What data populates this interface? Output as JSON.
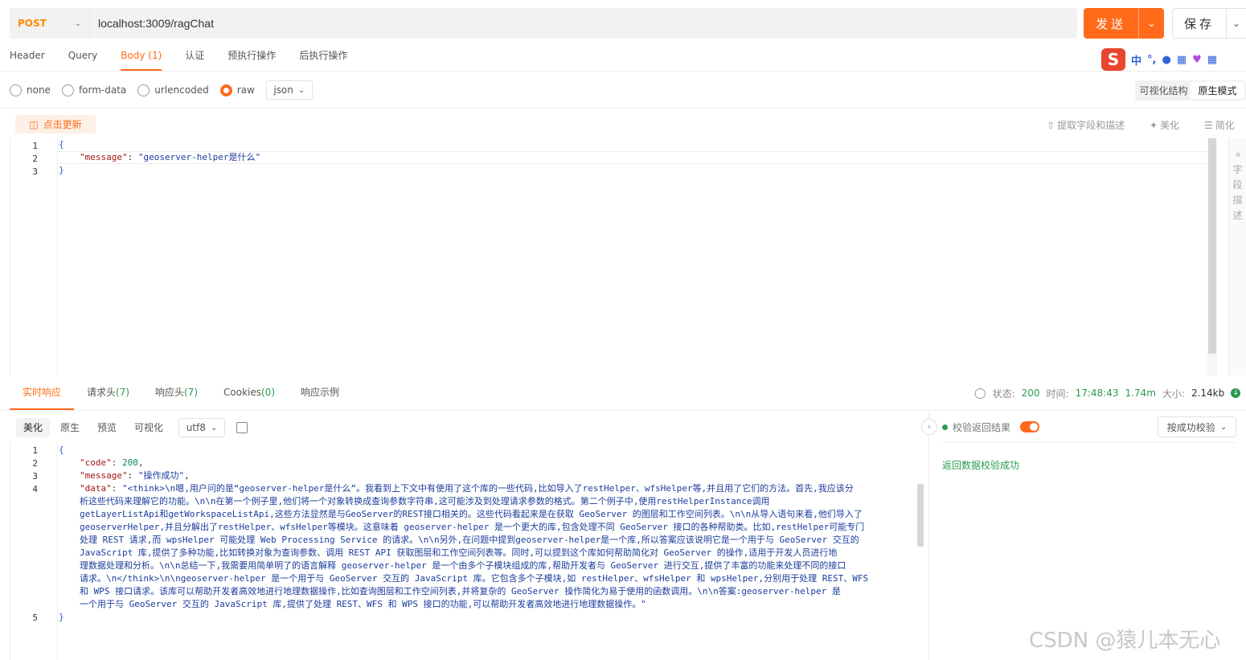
{
  "request": {
    "method": "POST",
    "url": "localhost:3009/ragChat",
    "send_label": "发送",
    "save_label": "保存"
  },
  "request_tabs": [
    {
      "label": "Header"
    },
    {
      "label": "Query"
    },
    {
      "label": "Body (1)"
    },
    {
      "label": "认证"
    },
    {
      "label": "预执行操作"
    },
    {
      "label": "后执行操作"
    }
  ],
  "ime": {
    "logo": "S",
    "mode": "中"
  },
  "body_types": [
    {
      "label": "none"
    },
    {
      "label": "form-data"
    },
    {
      "label": "urlencoded"
    },
    {
      "label": "raw"
    }
  ],
  "body_format": "json",
  "view_modes": {
    "visual": "可视化结构",
    "raw": "原生模式"
  },
  "editor_toolbar": {
    "update": "点击更新",
    "extract": "提取字段和描述",
    "beautify": "美化",
    "simplify": "简化"
  },
  "side_panel": {
    "label": "字段描述"
  },
  "request_body": {
    "lines": [
      "1",
      "2",
      "3"
    ],
    "open": "{",
    "key": "\"message\"",
    "value": "\"geoserver-helper是什么\"",
    "close": "}"
  },
  "response_tabs": [
    {
      "label": "实时响应",
      "count": ""
    },
    {
      "label": "请求头",
      "count": "(7)"
    },
    {
      "label": "响应头",
      "count": "(7)"
    },
    {
      "label": "Cookies",
      "count": "(0)"
    },
    {
      "label": "响应示例",
      "count": ""
    }
  ],
  "status_bar": {
    "status_label": "状态:",
    "status": "200",
    "time_label": "时间:",
    "time": "17:48:43",
    "duration": "1.74m",
    "size_label": "大小:",
    "size": "2.14kb"
  },
  "response_views": [
    "美化",
    "原生",
    "预览",
    "可视化"
  ],
  "encoding": "utf8",
  "response_body": {
    "line_numbers": [
      "1",
      "2",
      "3",
      "4",
      "5"
    ],
    "open": "{",
    "code_key": "\"code\"",
    "code_value": "200",
    "message_key": "\"message\"",
    "message_value": "\"操作成功\"",
    "data_key": "\"data\"",
    "data_lines": [
      "\"<think>\\n嗯,用户问的是“geoserver-helper是什么”。我看到上下文中有使用了这个库的一些代码,比如导入了restHelper、wfsHelper等,并且用了它们的方法。首先,我应该分",
      "析这些代码来理解它的功能。\\n\\n在第一个例子里,他们将一个对象转换成查询参数字符串,这可能涉及到处理请求参数的格式。第二个例子中,使用restHelperInstance调用",
      "getLayerListApi和getWorkspaceListApi,这些方法显然是与GeoServer的REST接口相关的。这些代码看起来是在获取 GeoServer 的图层和工作空间列表。\\n\\n从导入语句来看,他们导入了",
      "geoserverHelper,并且分解出了restHelper、wfsHelper等模块。这意味着 geoserver-helper 是一个更大的库,包含处理不同 GeoServer 接口的各种帮助类。比如,restHelper可能专门",
      "处理 REST 请求,而 wpsHelper 可能处理 Web Processing Service 的请求。\\n\\n另外,在问题中提到geoserver-helper是一个库,所以答案应该说明它是一个用于与 GeoServer 交互的",
      "JavaScript 库,提供了多种功能,比如转换对象为查询参数、调用 REST API 获取图层和工作空间列表等。同时,可以提到这个库如何帮助简化对 GeoServer 的操作,适用于开发人员进行地",
      "理数据处理和分析。\\n\\n总结一下,我需要用简单明了的语言解释 geoserver-helper 是一个由多个子模块组成的库,帮助开发者与 GeoServer 进行交互,提供了丰富的功能来处理不同的接口",
      "请求。\\n</think>\\n\\ngeoserver-helper 是一个用于与 GeoServer 交互的 JavaScript 库。它包含多个子模块,如 restHelper、wfsHelper 和 wpsHelper,分别用于处理 REST、WFS",
      "和 WPS 接口请求。该库可以帮助开发者高效地进行地理数据操作,比如查询图层和工作空间列表,并将复杂的 GeoServer 操作简化为易于使用的函数调用。\\n\\n答案:geoserver-helper 是",
      "一个用于与 GeoServer 交互的 JavaScript 库,提供了处理 REST、WFS 和 WPS 接口的功能,可以帮助开发者高效地进行地理数据操作。\""
    ],
    "close": "}"
  },
  "verification": {
    "toggle_label": "校验返回结果",
    "select_label": "按成功校验",
    "result": "返回数据校验成功"
  },
  "watermark": "CSDN @猿儿本无心",
  "colors": {
    "accent": "#ff6b1a",
    "success": "#2b9c4c",
    "method": "#ff8a00"
  }
}
